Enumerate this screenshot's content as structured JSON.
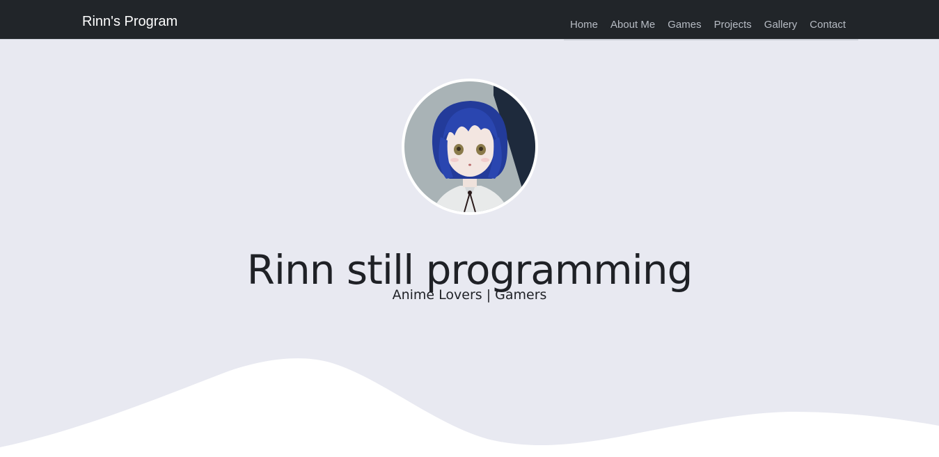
{
  "navbar": {
    "brand": "Rinn's Program",
    "links": [
      {
        "label": "Home"
      },
      {
        "label": "About Me"
      },
      {
        "label": "Games"
      },
      {
        "label": "Projects"
      },
      {
        "label": "Gallery"
      },
      {
        "label": "Contact"
      }
    ]
  },
  "hero": {
    "avatar_icon": "profile-avatar-icon",
    "title": "Rinn still programming",
    "subtitle": "Anime Lovers | Gamers"
  },
  "colors": {
    "navbar_bg": "#212529",
    "page_bg": "#e8e9f1",
    "wave": "#ffffff",
    "text": "#1f2126"
  }
}
